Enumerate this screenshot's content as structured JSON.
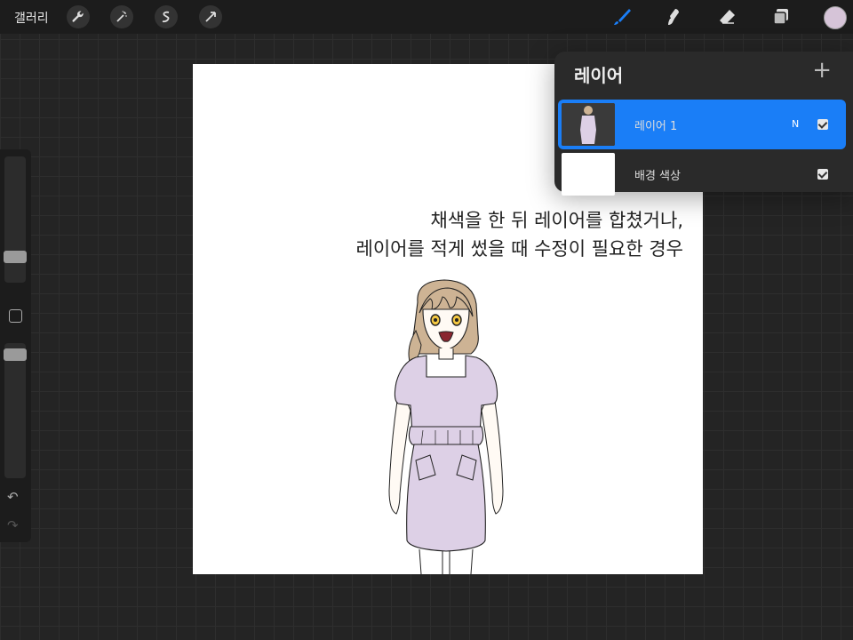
{
  "topbar": {
    "gallery_label": "갤러리",
    "actions_icon": "wrench-icon",
    "adjustments_icon": "magic-wand-icon",
    "selection_icon": "selection-icon",
    "transform_icon": "arrow-cursor-icon",
    "brush_icon": "brush-icon",
    "smudge_icon": "smudge-icon",
    "eraser_icon": "eraser-icon",
    "layers_icon": "layers-icon",
    "brush_color": "#1a7ef7",
    "current_color": "#d6c4d8"
  },
  "sidebar": {
    "undo_icon": "undo-icon",
    "redo_icon": "redo-icon"
  },
  "canvas": {
    "caption_line1": "채색을 한 뒤 레이어를 합쳤거나,",
    "caption_line2": "레이어를 적게 썼을 때 수정이 필요한 경우"
  },
  "layers_panel": {
    "title": "레이어",
    "add_icon": "+",
    "layers": [
      {
        "name": "레이어 1",
        "blend": "N",
        "visible": true,
        "selected": true
      },
      {
        "name": "배경 색상",
        "blend": "",
        "visible": true,
        "selected": false
      }
    ],
    "accent": "#1a7ef7"
  }
}
